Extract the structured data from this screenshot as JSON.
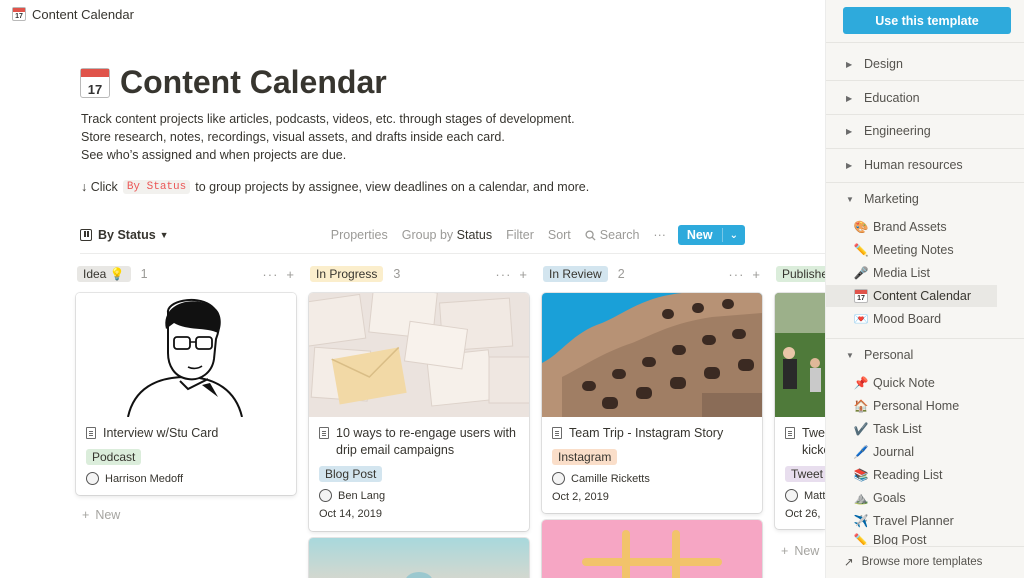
{
  "window": {
    "title": "Content Calendar",
    "icon_day": "17"
  },
  "page": {
    "title": "Content Calendar",
    "description": [
      "Track content projects like articles, podcasts, videos, etc. through stages of development.",
      "Store research, notes, recordings, visual assets, and drafts inside each card.",
      "See who’s assigned and when projects are due."
    ],
    "hint_prefix": "↓ Click",
    "hint_code": "By Status",
    "hint_suffix": "to group projects by assignee, view deadlines on a calendar, and more."
  },
  "toolbar": {
    "view_name": "By Status",
    "properties": "Properties",
    "group_by_prefix": "Group by",
    "group_by_value": "Status",
    "filter": "Filter",
    "sort": "Sort",
    "search": "Search",
    "more": "···",
    "new_label": "New",
    "new_caret": "⌄"
  },
  "columns": [
    {
      "name": "Idea 💡",
      "count": "1",
      "tag_bg": "#e8e7e4",
      "cards": [
        {
          "title": "Interview w/Stu Card",
          "tag": "Podcast",
          "tag_bg": "#dbeddb",
          "person": "Harrison Medoff",
          "date": ""
        }
      ],
      "add_label": "New"
    },
    {
      "name": "In Progress",
      "count": "3",
      "tag_bg": "#fbeecc",
      "cards": [
        {
          "title": "10 ways to re-engage users with drip email campaigns",
          "tag": "Blog Post",
          "tag_bg": "#d3e5ef",
          "person": "Ben Lang",
          "date": "Oct 14, 2019"
        }
      ]
    },
    {
      "name": "In Review",
      "count": "2",
      "tag_bg": "#d3e5ef",
      "cards": [
        {
          "title": "Team Trip - Instagram Story",
          "tag": "Instagram",
          "tag_bg": "#fadec9",
          "person": "Camille Ricketts",
          "date": "Oct 2, 2019"
        }
      ]
    },
    {
      "name": "Published",
      "count": "",
      "tag_bg": "#dbeddb",
      "cards": [
        {
          "title": "Tweet kickoff",
          "tag": "Tweet",
          "tag_bg": "#e8deee",
          "person": "Matt",
          "date": "Oct 26,"
        }
      ],
      "add_label": "New"
    }
  ],
  "sidebar": {
    "use_template": "Use this template",
    "categories": [
      "Design",
      "Education",
      "Engineering",
      "Human resources",
      "Marketing",
      "Personal"
    ],
    "marketing_items": [
      {
        "label": "Brand Assets",
        "icon": "🎨"
      },
      {
        "label": "Meeting Notes",
        "icon": "✏️"
      },
      {
        "label": "Media List",
        "icon": "🎤"
      },
      {
        "label": "Content Calendar",
        "icon": "calendar-icon"
      },
      {
        "label": "Mood Board",
        "icon": "💌"
      }
    ],
    "personal_items": [
      {
        "label": "Quick Note",
        "icon": "📌"
      },
      {
        "label": "Personal Home",
        "icon": "🏠"
      },
      {
        "label": "Task List",
        "icon": "✔️"
      },
      {
        "label": "Journal",
        "icon": "🖊️"
      },
      {
        "label": "Reading List",
        "icon": "📚"
      },
      {
        "label": "Goals",
        "icon": "⛰️"
      },
      {
        "label": "Travel Planner",
        "icon": "✈️"
      },
      {
        "label": "Blog Post",
        "icon": "✏️"
      }
    ],
    "browse": "Browse more templates"
  },
  "colors": {
    "accent": "#2eaadc",
    "code_text": "#eb5757",
    "sidebar_bg": "#f7f6f3"
  }
}
